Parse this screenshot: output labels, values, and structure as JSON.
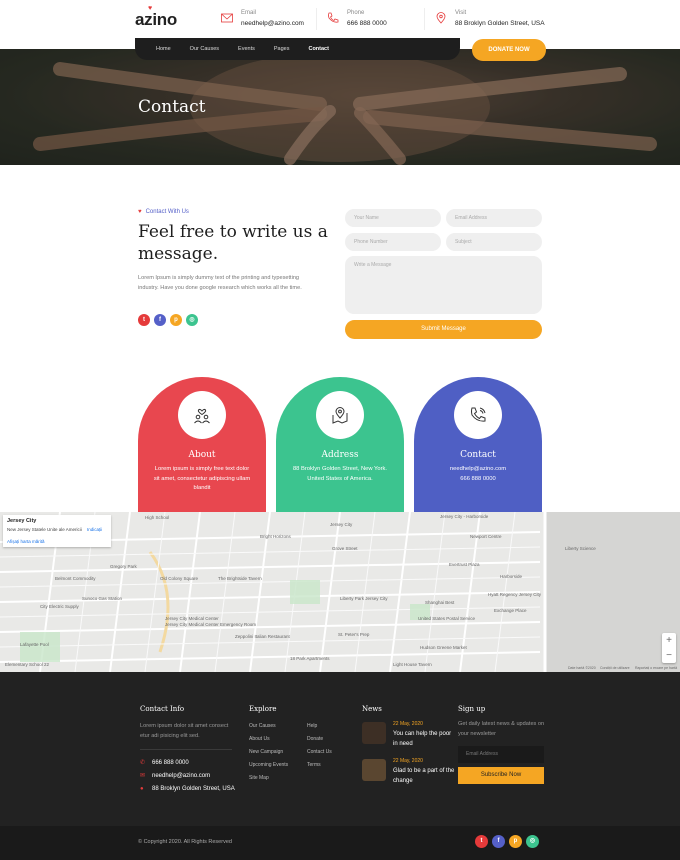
{
  "header": {
    "logo": "azino",
    "email": {
      "label": "Email",
      "value": "needhelp@azino.com"
    },
    "phone": {
      "label": "Phone",
      "value": "666 888 0000"
    },
    "visit": {
      "label": "Visit",
      "value": "88 Broklyn Golden Street, USA"
    },
    "nav": [
      {
        "label": "Home",
        "active": false
      },
      {
        "label": "Our Causes",
        "active": false
      },
      {
        "label": "Events",
        "active": false
      },
      {
        "label": "Pages",
        "active": false
      },
      {
        "label": "Contact",
        "active": true
      }
    ],
    "donate_label": "DONATE NOW"
  },
  "hero": {
    "title": "Contact"
  },
  "contact": {
    "tag": "Contact With Us",
    "headline": "Feel free to write us a message.",
    "paragraph": "Lorem Ipsum is simply dummy text of the printing and typesetting industry. Have you done google research which works all the time.",
    "socials": [
      {
        "icon": "twitter-icon",
        "glyph": "t",
        "color": "#e53a3a"
      },
      {
        "icon": "facebook-icon",
        "glyph": "f",
        "color": "#5560c8"
      },
      {
        "icon": "pinterest-icon",
        "glyph": "p",
        "color": "#f5a623"
      },
      {
        "icon": "instagram-icon",
        "glyph": "◎",
        "color": "#3cc48f"
      }
    ],
    "form": {
      "name_placeholder": "Your Name",
      "email_placeholder": "Email Address",
      "phone_placeholder": "Phone Number",
      "subject_placeholder": "Subject",
      "message_placeholder": "Write a Message",
      "submit_label": "Submit Message"
    }
  },
  "cards": [
    {
      "title": "About",
      "text": "Lorem ipsum is simply free text dolor sit amet, consectetur adipiscing ullam blandit",
      "color": "#e8474f",
      "icon": "people-heart-icon"
    },
    {
      "title": "Address",
      "text": "88 Broklyn Golden Street, New York. United States of America.",
      "color": "#3cc48f",
      "icon": "map-pin-icon"
    },
    {
      "title": "Contact",
      "text": "needhelp@azino.com\n666 888 0000",
      "text_line1": "needhelp@azino.com",
      "text_line2": "666 888 0000",
      "color": "#4f5fc4",
      "icon": "phone-icon"
    }
  ],
  "map": {
    "place_title": "Jersey City",
    "place_sub": "New Jersey Statele Unite ale Americii",
    "directions": "Indicații",
    "larger_map": "Afișați harta mărită",
    "labels": [
      "High School",
      "Jersey City",
      "Jersey City - Harborside",
      "Grove Street",
      "Exchange Place",
      "Newport Centre",
      "Jersey City Medical Center",
      "Liberty Science",
      "City Electric Supply",
      "Lafayette Pool",
      "Gregory Park",
      "Hyatt Regency Jersey City",
      "Shanghai Best",
      "Hudson Greene Market",
      "Light House Tavern",
      "18 Park Apartments",
      "Zeppolini Italian Restaurant",
      "St. Peter's Prep",
      "Harborside",
      "Belmont Commodity",
      "Old Colony Square",
      "The Brightside Tavern",
      "Evertrust Plaza",
      "Liberty Park Jersey City",
      "United States Postal Service",
      "Bright Horizons",
      "Elementary School 22",
      "Sunoco Gas Station",
      "Jersey City Medical Center Emergency Room"
    ],
    "footer_text": "Date hartă ©2020",
    "terms": "Condiții de utilizare",
    "report": "Raportați o eroare pe hartă"
  },
  "footer": {
    "contact_info": {
      "title": "Contact Info",
      "text": "Lorem ipsum dolor sit amet consect etur adi pisicing elit sed.",
      "phone": "666 888 0000",
      "email": "needhelp@azino.com",
      "address": "88 Broklyn Golden Street, USA"
    },
    "explore": {
      "title": "Explore",
      "col1": [
        "Our Causes",
        "About Us",
        "New Campaign",
        "Upcoming Events",
        "Site Map"
      ],
      "col2": [
        "Help",
        "Donate",
        "Contact Us",
        "Terms"
      ]
    },
    "news": {
      "title": "News",
      "items": [
        {
          "date": "22 May, 2020",
          "title": "You can help the poor in need"
        },
        {
          "date": "22 May, 2020",
          "title": "Glad to be a part of the change"
        }
      ]
    },
    "signup": {
      "title": "Sign up",
      "text": "Get daily latest news & updates on your newsletter",
      "email_placeholder": "Email Address",
      "subscribe_label": "Subscribe Now"
    },
    "copyright": "© Copyright 2020. All Rights Reserved"
  }
}
